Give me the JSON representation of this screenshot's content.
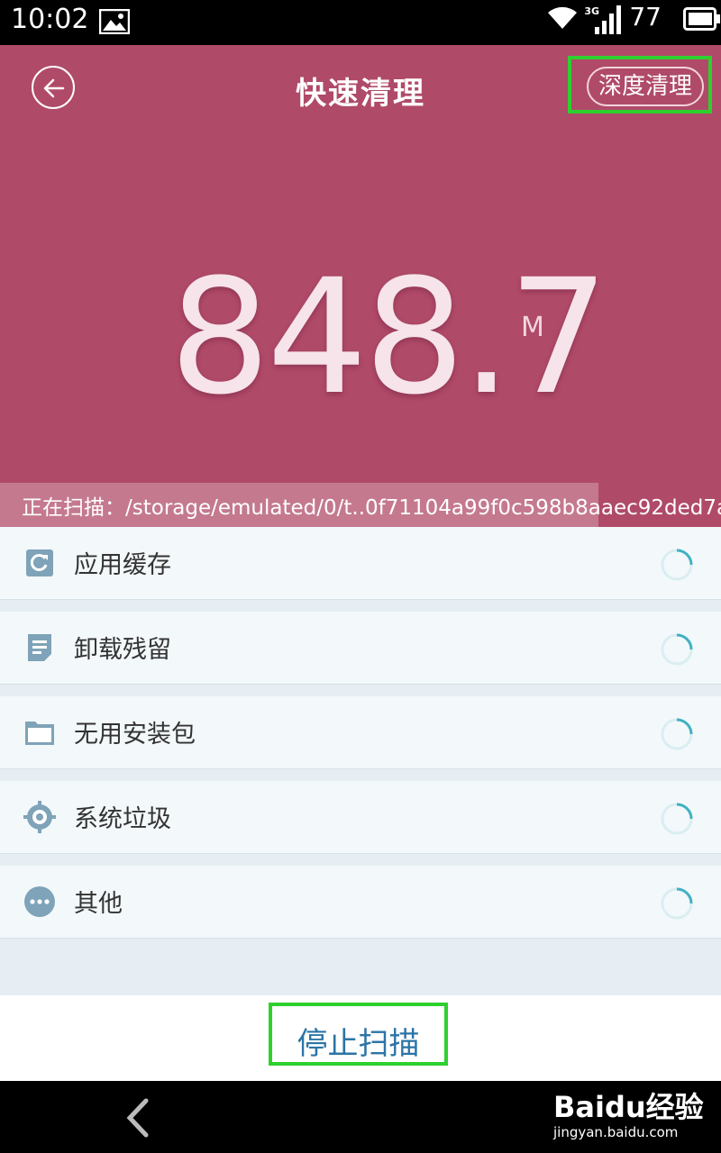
{
  "status_bar": {
    "time": "10:02",
    "network": "3G",
    "battery": "77",
    "icons": [
      "image-icon",
      "wifi-icon",
      "signal-icon",
      "battery-icon"
    ]
  },
  "header": {
    "title": "快速清理",
    "back_icon": "back-arrow-icon",
    "deep_clean_label": "深度清理",
    "size_value": "848.7",
    "size_unit": "M",
    "scan_path": "正在扫描：/storage/emulated/0/t..0f71104a99f0c598b8aaec92ded7a"
  },
  "list": {
    "items": [
      {
        "label": "应用缓存",
        "icon": "cache-refresh-icon"
      },
      {
        "label": "卸载残留",
        "icon": "document-icon"
      },
      {
        "label": "无用安装包",
        "icon": "folder-icon"
      },
      {
        "label": "系统垃圾",
        "icon": "system-gear-icon"
      },
      {
        "label": "其他",
        "icon": "more-dots-icon"
      }
    ]
  },
  "footer": {
    "stop_label": "停止扫描"
  },
  "watermark": {
    "logo": "Baidu经验",
    "site": "jingyan.baidu.com"
  },
  "colors": {
    "header_bg": "#b04a69",
    "list_bg": "#e6eef3",
    "icon_color": "#7fa3b8",
    "stop_text": "#2c74a6",
    "highlight": "#2ed02e"
  }
}
